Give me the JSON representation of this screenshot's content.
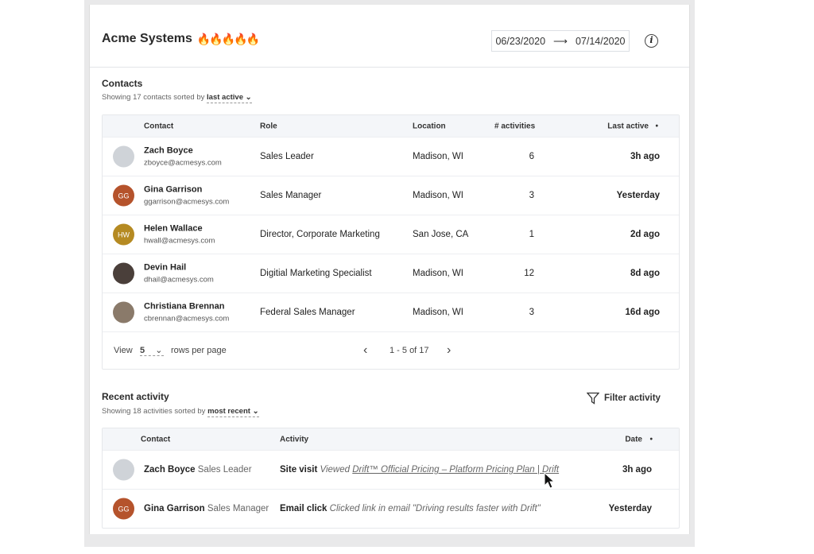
{
  "header": {
    "title": "Acme Systems",
    "flames": "🔥🔥🔥🔥🔥",
    "flame_color": "#e9a27c",
    "date_start": "06/23/2020",
    "date_arrow": "⟶",
    "date_end": "07/14/2020",
    "info_icon": "i"
  },
  "contacts": {
    "title": "Contacts",
    "subtitle_prefix": "Showing 17 contacts sorted by",
    "sort": "last active",
    "chevron": "⌄",
    "columns": [
      "Contact",
      "Role",
      "Location",
      "# activities",
      "Last active",
      "•"
    ],
    "rows": [
      {
        "initials": "",
        "avatar_color": "#cfd3d8",
        "name": "Zach Boyce",
        "email": "zboyce@acmesys.com",
        "role": "Sales Leader",
        "location": "Madison, WI",
        "activities": "6",
        "last_active": "3h ago"
      },
      {
        "initials": "GG",
        "avatar_color": "#b5532c",
        "name": "Gina Garrison",
        "email": "ggarrison@acmesys.com",
        "role": "Sales Manager",
        "location": "Madison, WI",
        "activities": "3",
        "last_active": "Yesterday"
      },
      {
        "initials": "HW",
        "avatar_color": "#b58a22",
        "name": "Helen Wallace",
        "email": "hwall@acmesys.com",
        "role": "Director, Corporate Marketing",
        "location": "San Jose, CA",
        "activities": "1",
        "last_active": "2d ago"
      },
      {
        "initials": "",
        "avatar_color": "#4a3f3a",
        "name": "Devin Hail",
        "email": "dhail@acmesys.com",
        "role": "Digitial Marketing Specialist",
        "location": "Madison, WI",
        "activities": "12",
        "last_active": "8d ago"
      },
      {
        "initials": "",
        "avatar_color": "#8a7a6a",
        "name": "Christiana Brennan",
        "email": "cbrennan@acmesys.com",
        "role": "Federal Sales Manager",
        "location": "Madison, WI",
        "activities": "3",
        "last_active": "16d ago"
      }
    ],
    "footer": {
      "view": "View",
      "per_page": "5",
      "rows_per_page": "rows per page",
      "prev": "‹",
      "range": "1 - 5 of 17",
      "next": "›"
    }
  },
  "activity": {
    "title": "Recent activity",
    "subtitle_prefix": "Showing 18 activities sorted by",
    "sort": "most recent",
    "chevron": "⌄",
    "filter_label": "Filter activity",
    "columns": [
      "Contact",
      "Activity",
      "Date",
      "•"
    ],
    "rows": [
      {
        "initials": "",
        "avatar_color": "#cfd3d8",
        "name": "Zach Boyce",
        "role": "Sales Leader",
        "type": "Site visit",
        "desc_prefix": "Viewed",
        "desc_link": "Drift™ Official Pricing – Platform Pricing Plan | Drift",
        "date": "3h ago"
      },
      {
        "initials": "GG",
        "avatar_color": "#b5532c",
        "name": "Gina Garrison",
        "role": "Sales Manager",
        "type": "Email click",
        "desc_prefix": "Clicked link in email \"Driving results faster with Drift\"",
        "desc_link": "",
        "date": "Yesterday"
      }
    ]
  }
}
